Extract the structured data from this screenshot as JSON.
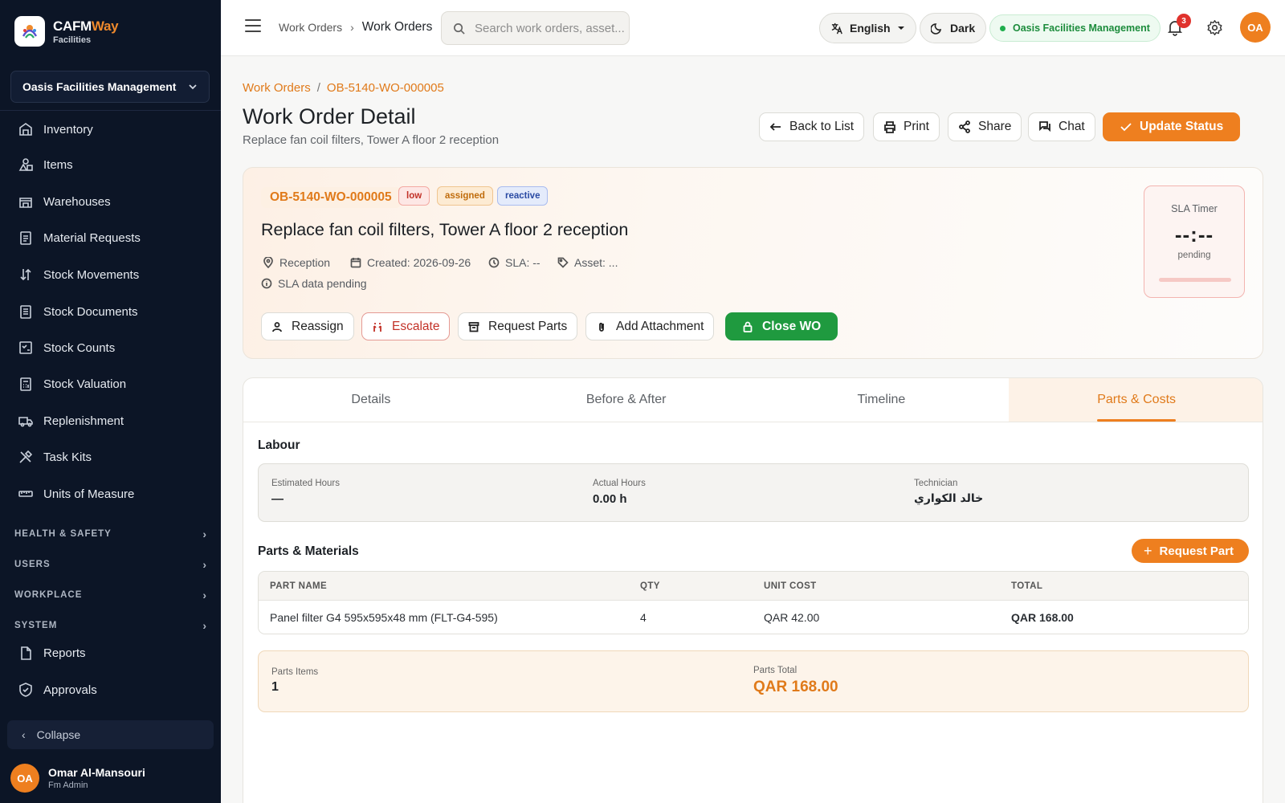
{
  "app": {
    "brand_a": "CAFM",
    "brand_b": "Way",
    "brand_sub": "Facilities"
  },
  "sidebar": {
    "org": "Oasis Facilities Management",
    "items": [
      {
        "label": "Inventory",
        "icon": "building-icon"
      },
      {
        "label": "Items",
        "icon": "shapes-icon"
      },
      {
        "label": "Warehouses",
        "icon": "warehouse-icon"
      },
      {
        "label": "Material Requests",
        "icon": "clipboard-icon"
      },
      {
        "label": "Stock Movements",
        "icon": "arrows-icon"
      },
      {
        "label": "Stock Documents",
        "icon": "document-icon"
      },
      {
        "label": "Stock Counts",
        "icon": "checklist-icon"
      },
      {
        "label": "Stock Valuation",
        "icon": "calculator-icon"
      },
      {
        "label": "Replenishment",
        "icon": "truck-icon"
      },
      {
        "label": "Task Kits",
        "icon": "tools-icon"
      },
      {
        "label": "Units of Measure",
        "icon": "ruler-icon"
      }
    ],
    "sections": [
      "HEALTH & SAFETY",
      "USERS",
      "WORKPLACE",
      "SYSTEM"
    ],
    "bottom_items": [
      {
        "label": "Reports",
        "icon": "report-icon"
      },
      {
        "label": "Approvals",
        "icon": "shield-check-icon"
      }
    ],
    "collapse": "Collapse",
    "user": {
      "initials": "OA",
      "name": "Omar Al-Mansouri",
      "role": "Fm Admin"
    }
  },
  "topbar": {
    "breadcrumb_parent": "Work Orders",
    "breadcrumb_current": "Work Orders",
    "search_placeholder": "Search work orders, asset...",
    "language": "English",
    "theme": "Dark",
    "org": "Oasis Facilities Management",
    "notifications": "3",
    "avatar": "OA"
  },
  "page": {
    "bc_root": "Work Orders",
    "bc_id": "OB-5140-WO-000005",
    "title": "Work Order Detail",
    "subtitle": "Replace fan coil filters, Tower A floor 2 reception",
    "actions": {
      "back": "Back to List",
      "print": "Print",
      "share": "Share",
      "chat": "Chat",
      "update": "Update Status"
    }
  },
  "summary": {
    "id": "OB-5140-WO-000005",
    "tags": {
      "priority": "low",
      "status": "assigned",
      "type": "reactive"
    },
    "title": "Replace fan coil filters, Tower A floor 2 reception",
    "location": "Reception",
    "created": "Created: 2026-09-26",
    "sla": "SLA: --",
    "asset": "Asset: ...",
    "sla_note": "SLA data pending",
    "buttons": {
      "reassign": "Reassign",
      "escalate": "Escalate",
      "request_parts": "Request Parts",
      "attach": "Add Attachment",
      "close": "Close WO"
    },
    "sla_timer": {
      "label": "SLA Timer",
      "value": "--:--",
      "state": "pending"
    },
    "colors": {
      "accent": "#ee7f1f",
      "success": "#1f9a3f",
      "danger": "#c23127"
    }
  },
  "tabs": [
    "Details",
    "Before & After",
    "Timeline",
    "Parts & Costs"
  ],
  "labour": {
    "title": "Labour",
    "estimated_label": "Estimated Hours",
    "estimated_value": "—",
    "actual_label": "Actual Hours",
    "actual_value": "0.00 h",
    "tech_label": "Technician",
    "tech_value": "خالد الكواري"
  },
  "parts": {
    "title": "Parts & Materials",
    "request_button": "Request Part",
    "headers": [
      "PART NAME",
      "QTY",
      "UNIT COST",
      "TOTAL"
    ],
    "rows": [
      {
        "name": "Panel filter G4 595x595x48 mm (FLT-G4-595)",
        "qty": "4",
        "unit": "QAR 42.00",
        "total": "QAR 168.00"
      }
    ],
    "items_label": "Parts Items",
    "items_value": "1",
    "total_label": "Parts Total",
    "total_value": "QAR 168.00"
  }
}
